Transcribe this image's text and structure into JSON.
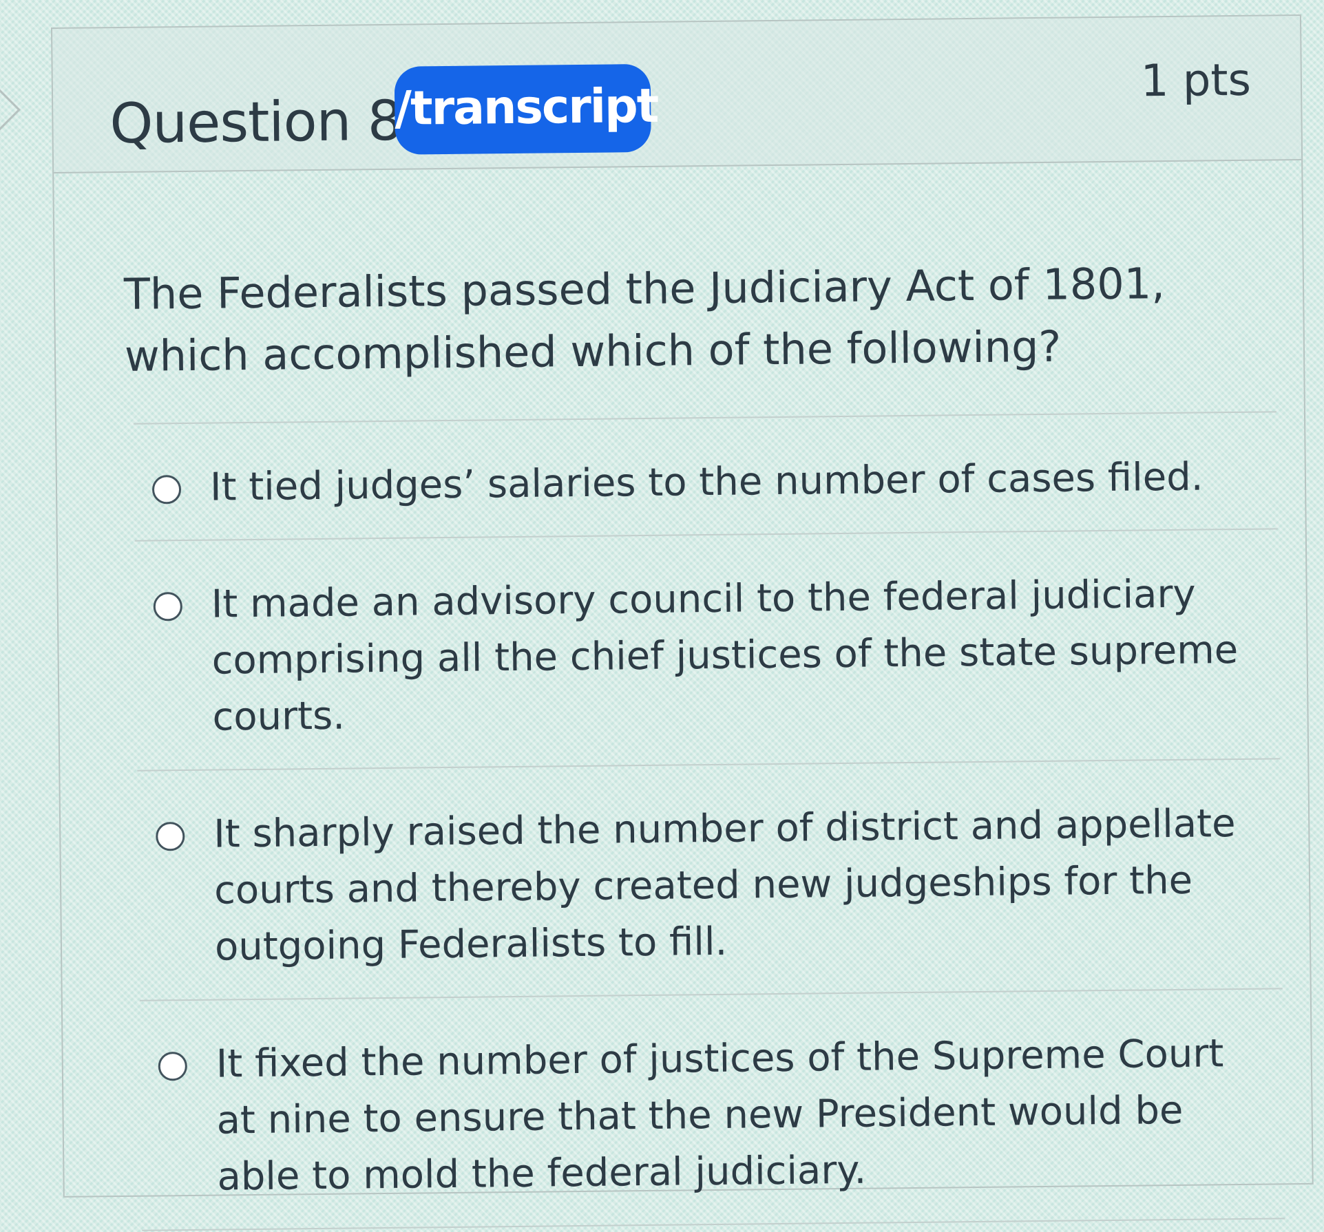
{
  "question": {
    "title": "Question 8",
    "points": "1 pts",
    "badge_label": "/transcript",
    "text": "The Federalists passed the Judiciary Act of 1801, which accomplished which of the following?"
  },
  "answers": [
    {
      "label": "It tied judges’ salaries to the number of cases filed."
    },
    {
      "label": "It made an advisory council to the federal judiciary comprising all the chief justices of the state supreme courts."
    },
    {
      "label": "It sharply raised the number of district and appellate courts and thereby created new judgeships for the outgoing Federalists to fill."
    },
    {
      "label": "It fixed the number of justices of the Supreme Court at nine to ensure that the new President would be able to mold the federal judiciary."
    }
  ],
  "colors": {
    "badge": "#1565e8",
    "text": "#2d3b45",
    "border": "#b7c4c2"
  },
  "icons": {
    "radio": "radio-unchecked-icon",
    "nav": "chevron-right-icon"
  }
}
